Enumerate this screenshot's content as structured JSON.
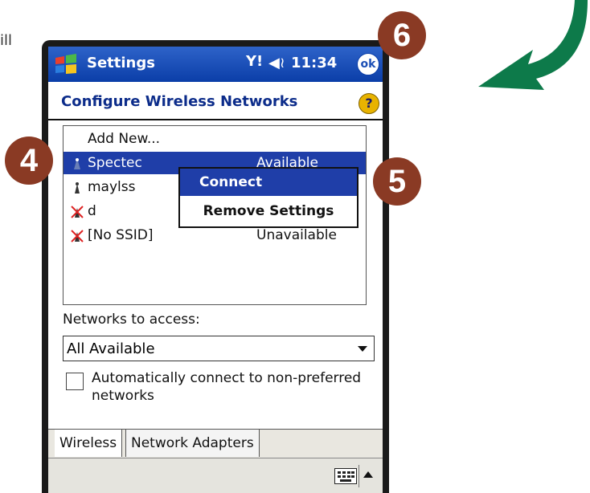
{
  "fragment_text": "ill",
  "titlebar": {
    "app_title": "Settings",
    "time": "11:34",
    "ok_label": "ok",
    "start_icon": "windows-flag-icon",
    "signal_icon": "antenna-icon",
    "volume_icon": "speaker-icon"
  },
  "page": {
    "heading": "Configure Wireless Networks",
    "help_label": "?"
  },
  "networks": {
    "add_new": "Add New...",
    "items": [
      {
        "name": "Spectec",
        "status": "Available",
        "selected": true
      },
      {
        "name": "maylss",
        "status": ""
      },
      {
        "name": "d",
        "status": ""
      },
      {
        "name": "[No SSID]",
        "status": "Unavailable"
      }
    ]
  },
  "context_menu": {
    "items": [
      "Connect",
      "Remove Settings"
    ]
  },
  "access": {
    "label": "Networks to access:",
    "selected": "All Available"
  },
  "autoconnect": {
    "label": "Automatically connect to non-preferred networks",
    "checked": false
  },
  "tabs": [
    "Wireless",
    "Network Adapters"
  ],
  "callouts": [
    "4",
    "5",
    "6"
  ],
  "colors": {
    "titlebar": "#1c4fb5",
    "selection": "#1f3ea8",
    "callout": "#8a3a24",
    "arrow": "#0d7a4a"
  }
}
